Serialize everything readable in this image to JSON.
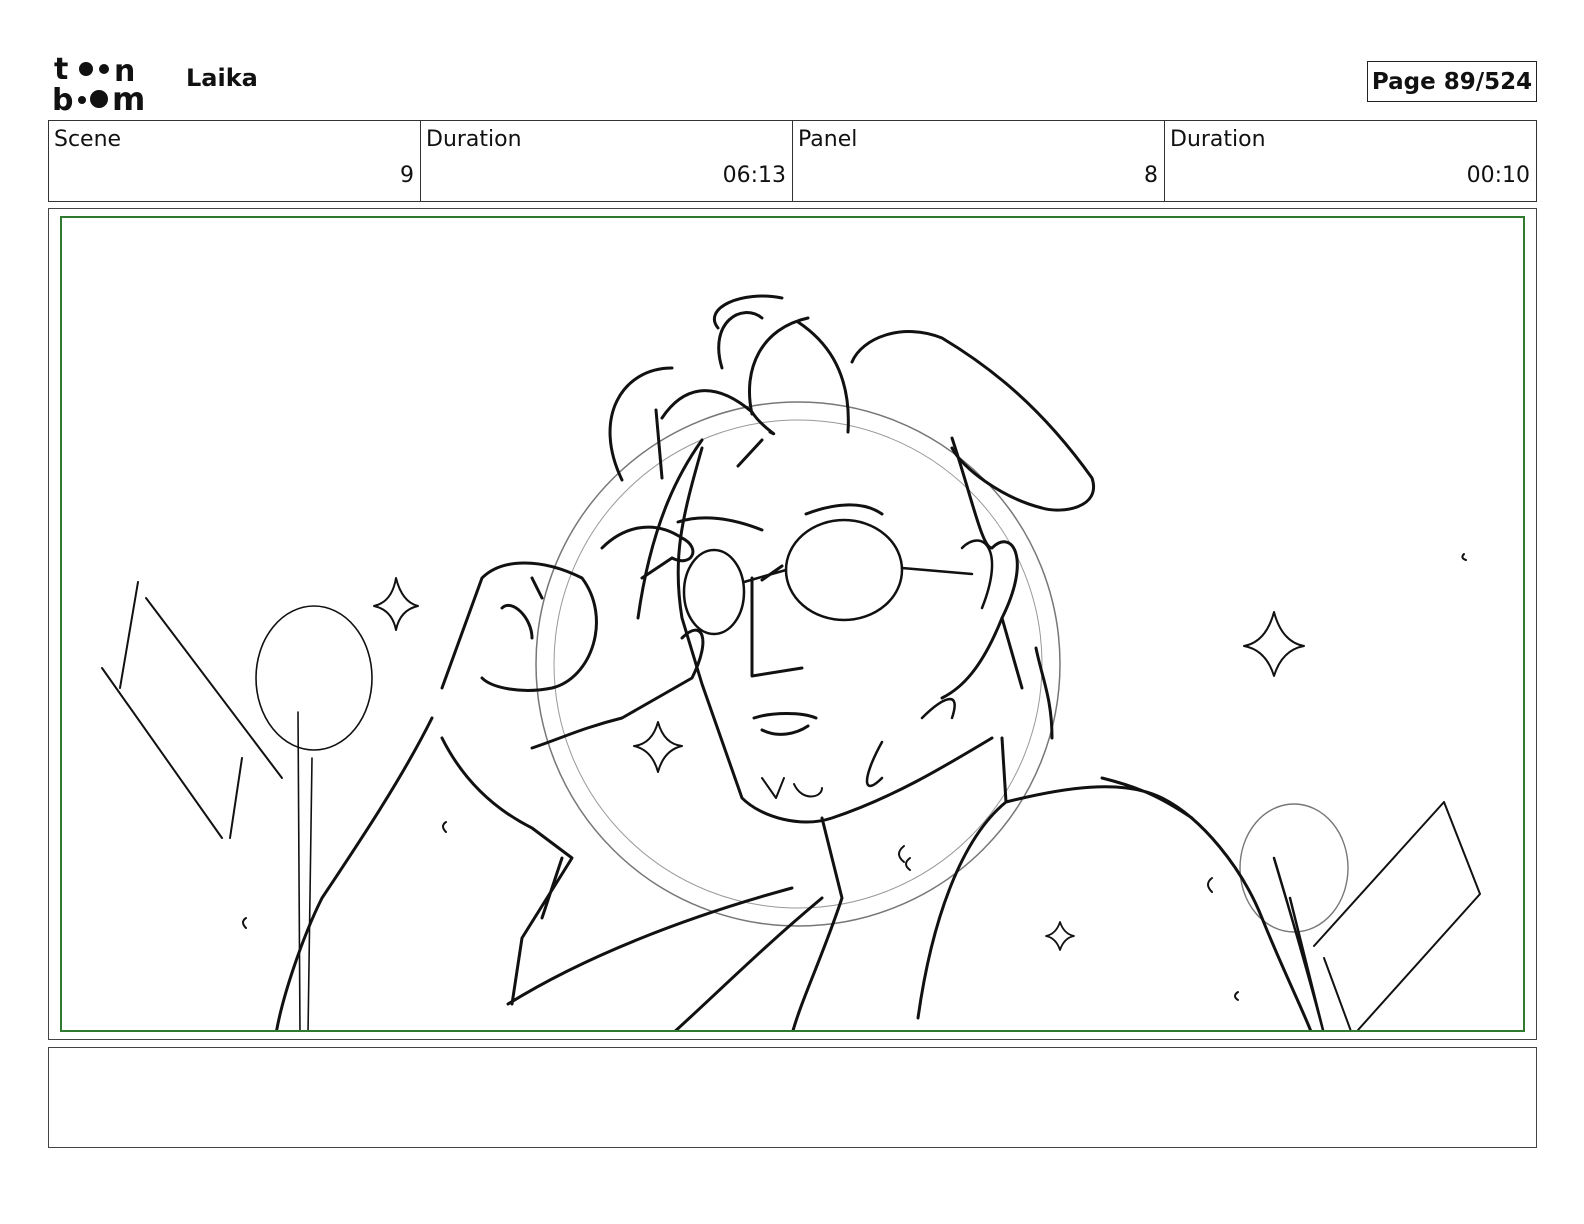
{
  "header": {
    "logo_text_top": "toon",
    "logo_text_bottom": "boom",
    "project_name": "Laika",
    "page_label": "Page",
    "page_value": "89/524"
  },
  "info": {
    "scene_label": "Scene",
    "scene_value": "9",
    "scene_duration_label": "Duration",
    "scene_duration_value": "06:13",
    "panel_label": "Panel",
    "panel_value": "8",
    "panel_duration_label": "Duration",
    "panel_duration_value": "00:10"
  },
  "panel": {
    "frame_color": "#2f7a2f",
    "sketch_color": "#111111"
  },
  "notes": {
    "text": ""
  }
}
